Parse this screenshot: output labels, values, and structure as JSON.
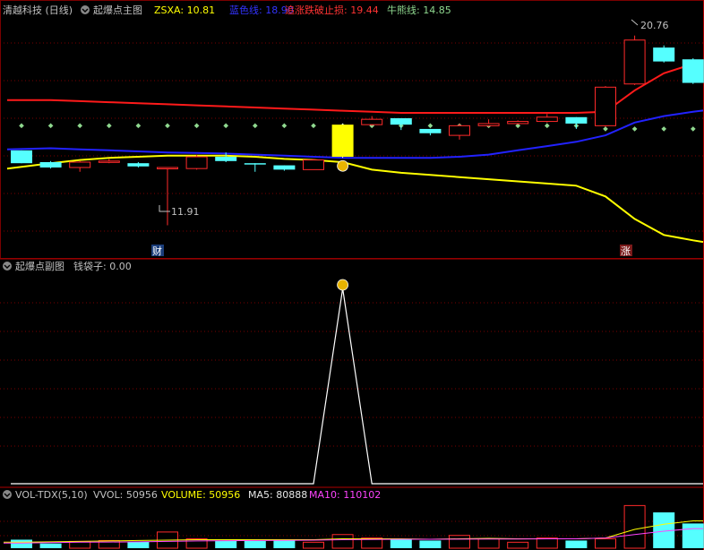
{
  "colors": {
    "bg": "#000000",
    "grid": "#7a0000",
    "rise": "#ff2a2a",
    "fall": "#55ffff",
    "yellow": "#ffff00",
    "blue": "#2222ff",
    "red": "#ff1a1a",
    "green_dot": "#8fd88f",
    "white": "#ffffff",
    "label_grey": "#c0c0c0",
    "magenta": "#ff44ff",
    "gold": "#e8b400"
  },
  "main_header": {
    "stock": "清越科技 (日线)",
    "panel": "起爆点主图",
    "zsxa_label": "ZSXA: 10.81",
    "blue_label": "蓝色线: 18.90",
    "red_label": "追涨跌破止损: 19.44",
    "bull_label": "牛熊线: 14.85"
  },
  "sub_header": {
    "panel": "起爆点副图",
    "value": "钱袋子: 0.00"
  },
  "vol_header": {
    "name": "VOL-TDX(5,10)",
    "vvol": "VVOL: 50956",
    "volume": "VOLUME: 50956",
    "ma5": "MA5: 80888",
    "ma10": "MA10: 110102"
  },
  "annotations": {
    "high": "20.76",
    "low": "11.91",
    "badge_cai": "财",
    "badge_zhang": "涨",
    "money_icon": "moneybag-icon"
  },
  "chart_data": {
    "type": "candlestick",
    "price_axis": [
      10.5,
      21.5
    ],
    "candles": [
      {
        "o": 15.4,
        "h": 15.4,
        "c": 14.8,
        "l": 14.8
      },
      {
        "o": 14.85,
        "h": 14.9,
        "c": 14.6,
        "l": 14.55
      },
      {
        "o": 14.6,
        "h": 14.9,
        "c": 14.85,
        "l": 14.4
      },
      {
        "o": 14.85,
        "h": 15.0,
        "c": 14.9,
        "l": 14.8
      },
      {
        "o": 14.8,
        "h": 14.85,
        "c": 14.65,
        "l": 14.6
      },
      {
        "o": 14.6,
        "h": 14.6,
        "c": 14.6,
        "l": 11.9
      },
      {
        "o": 14.55,
        "h": 15.2,
        "c": 15.1,
        "l": 14.5
      },
      {
        "o": 15.1,
        "h": 15.3,
        "c": 14.9,
        "l": 14.85
      },
      {
        "o": 14.8,
        "h": 14.8,
        "c": 14.75,
        "l": 14.4
      },
      {
        "o": 14.7,
        "h": 14.7,
        "c": 14.5,
        "l": 14.45
      },
      {
        "o": 14.5,
        "h": 15.0,
        "c": 14.95,
        "l": 14.5
      },
      {
        "o": 15.1,
        "h": 16.65,
        "c": 16.6,
        "l": 15.05
      },
      {
        "o": 16.6,
        "h": 17.0,
        "c": 16.85,
        "l": 16.55
      },
      {
        "o": 16.9,
        "h": 16.9,
        "c": 16.6,
        "l": 16.35
      },
      {
        "o": 16.4,
        "h": 16.4,
        "c": 16.2,
        "l": 16.1
      },
      {
        "o": 16.1,
        "h": 16.65,
        "c": 16.55,
        "l": 15.9
      },
      {
        "o": 16.55,
        "h": 16.85,
        "c": 16.65,
        "l": 16.5
      },
      {
        "o": 16.65,
        "h": 16.8,
        "c": 16.75,
        "l": 16.6
      },
      {
        "o": 16.75,
        "h": 17.1,
        "c": 16.95,
        "l": 16.7
      },
      {
        "o": 16.95,
        "h": 16.95,
        "c": 16.65,
        "l": 16.4
      },
      {
        "o": 16.55,
        "h": 18.4,
        "c": 18.35,
        "l": 16.5
      },
      {
        "o": 18.5,
        "h": 20.76,
        "c": 20.55,
        "l": 18.45
      },
      {
        "o": 20.2,
        "h": 20.3,
        "c": 19.55,
        "l": 19.5
      },
      {
        "o": 19.65,
        "h": 19.7,
        "c": 18.55,
        "l": 18.5
      }
    ],
    "highlight_index": 11,
    "dots": [
      16.55,
      16.55,
      16.55,
      16.55,
      16.55,
      16.55,
      16.55,
      16.55,
      16.55,
      16.55,
      16.55,
      16.55,
      16.55,
      16.55,
      16.55,
      16.55,
      16.55,
      16.55,
      16.55,
      16.55,
      16.4,
      16.4,
      16.4,
      16.4
    ],
    "red_line": [
      17.75,
      17.75,
      17.7,
      17.65,
      17.6,
      17.55,
      17.5,
      17.45,
      17.4,
      17.35,
      17.3,
      17.25,
      17.2,
      17.15,
      17.15,
      17.15,
      17.15,
      17.15,
      17.15,
      17.15,
      17.2,
      18.2,
      19.0,
      19.44
    ],
    "blue_line": [
      15.45,
      15.5,
      15.45,
      15.4,
      15.35,
      15.3,
      15.28,
      15.25,
      15.2,
      15.15,
      15.1,
      15.05,
      15.05,
      15.05,
      15.05,
      15.1,
      15.2,
      15.4,
      15.6,
      15.8,
      16.1,
      16.7,
      17.0,
      17.2
    ],
    "yellow_line": [
      14.55,
      14.8,
      14.95,
      15.05,
      15.1,
      15.15,
      15.15,
      15.15,
      15.1,
      15.0,
      14.95,
      14.85,
      14.5,
      14.35,
      14.25,
      14.15,
      14.05,
      13.95,
      13.85,
      13.75,
      13.25,
      12.2,
      11.45,
      11.2
    ],
    "signal": [
      0,
      0,
      0,
      0,
      0,
      0,
      0,
      0,
      0,
      0,
      0,
      1,
      0,
      0,
      0,
      0,
      0,
      0,
      0,
      0,
      0,
      0,
      0,
      0
    ],
    "volume": [
      1.0,
      0.55,
      0.8,
      0.9,
      0.75,
      1.9,
      1.1,
      0.9,
      0.85,
      1.0,
      0.7,
      1.6,
      1.2,
      1.1,
      0.9,
      1.5,
      1.1,
      0.7,
      1.2,
      0.9,
      1.1,
      5.0,
      4.2,
      2.9
    ],
    "vol_ma": [
      0.7,
      0.75,
      0.8,
      0.85,
      0.9,
      0.95,
      1.0,
      1.0,
      1.0,
      1.0,
      1.0,
      1.1,
      1.1,
      1.1,
      1.05,
      1.1,
      1.15,
      1.1,
      1.1,
      1.1,
      1.2,
      2.2,
      2.8,
      3.2
    ],
    "vol_ma2": [
      0.6,
      0.65,
      0.7,
      0.72,
      0.75,
      0.8,
      0.85,
      0.88,
      0.9,
      0.92,
      0.95,
      1.0,
      1.02,
      1.05,
      1.05,
      1.06,
      1.08,
      1.08,
      1.1,
      1.1,
      1.2,
      1.6,
      2.0,
      2.3
    ]
  }
}
